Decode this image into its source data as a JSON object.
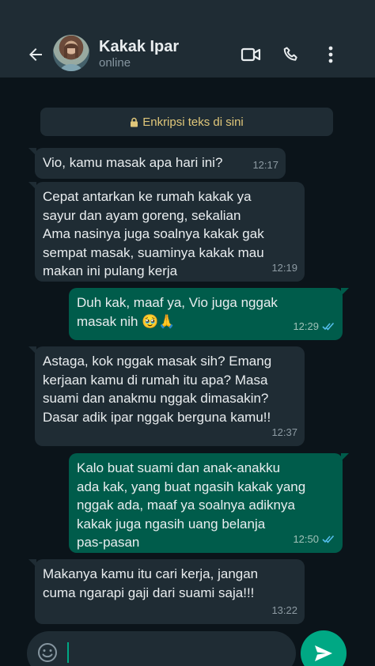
{
  "header": {
    "name": "Kakak Ipar",
    "status": "online",
    "icons": [
      "back-arrow-icon",
      "video-call-icon",
      "voice-call-icon",
      "more-options-icon"
    ]
  },
  "encryption": {
    "text": "Enkripsi teks di sini",
    "icon": "lock-icon"
  },
  "messages": [
    {
      "dir": "in",
      "text": "Vio, kamu masak apa hari ini?",
      "time": "12:17"
    },
    {
      "dir": "in",
      "text": "Cepat antarkan ke rumah kakak ya\nsayur dan ayam goreng, sekalian\nAma nasinya juga soalnya kakak gak\nsempat masak, suaminya kakak mau\nmakan ini pulang kerja",
      "time": "12:19"
    },
    {
      "dir": "out",
      "text": "Duh kak, maaf ya, Vio juga nggak\nmasak nih 🥹🙏",
      "time": "12:29"
    },
    {
      "dir": "in",
      "text": "Astaga, kok nggak masak sih? Emang\nkerjaan kamu di rumah itu apa? Masa\nsuami dan anakmu nggak dimasakin?\nDasar adik ipar nggak berguna kamu!!",
      "time": "12:37"
    },
    {
      "dir": "out",
      "text": "Kalo buat suami dan anak-anakku\nada kak, yang buat ngasih kakak yang\nnggak ada, maaf ya soalnya adiknya\nkakak juga ngasih uang belanja\npas-pasan",
      "time": "12:50"
    },
    {
      "dir": "in",
      "text": "Makanya kamu itu cari kerja, jangan\ncuma ngarapi gaji dari suami saja!!!",
      "time": "13:22"
    }
  ],
  "composer": {
    "value": "",
    "emoji_icon": "emoji-icon",
    "send_icon": "send-icon"
  },
  "colors": {
    "incoming": "#1f2c34",
    "outgoing": "#005c4b",
    "accent": "#00a884",
    "read_ticks": "#53bdeb"
  }
}
